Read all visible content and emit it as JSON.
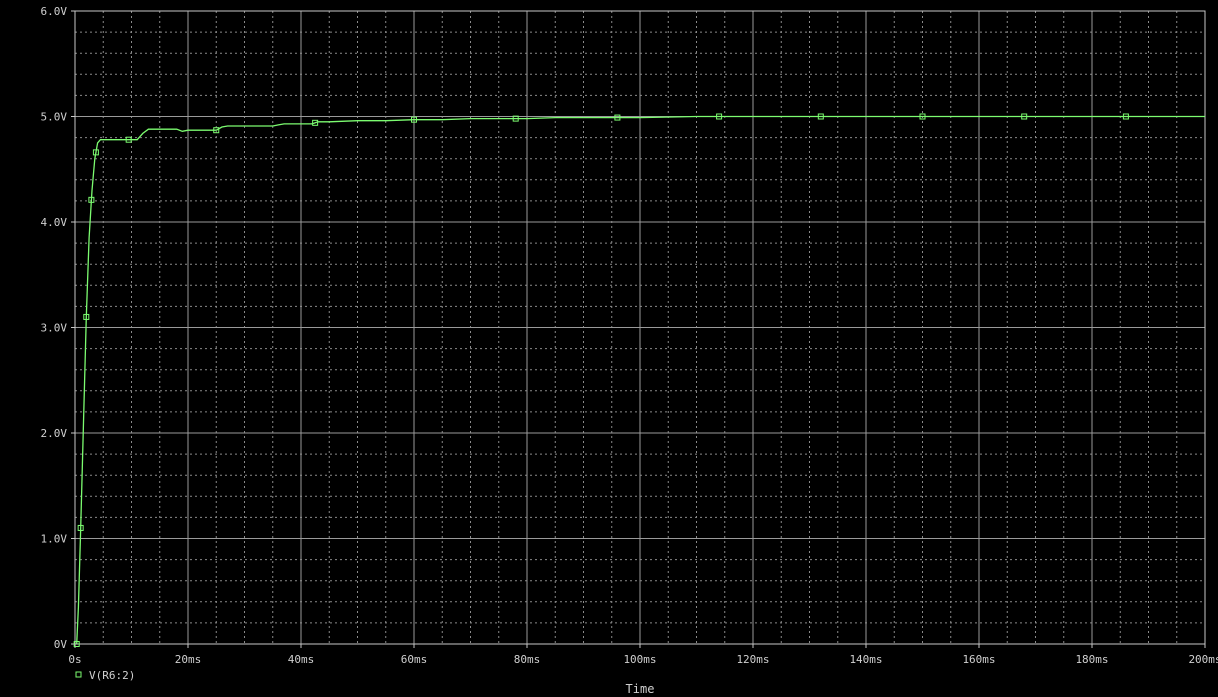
{
  "chart_data": {
    "type": "line",
    "xlabel": "Time",
    "ylabel": "",
    "xlim": [
      0,
      200
    ],
    "ylim": [
      0,
      6
    ],
    "grid": true,
    "legend_placement": "bottom-left",
    "x_ticks": [
      "0s",
      "20ms",
      "40ms",
      "60ms",
      "80ms",
      "100ms",
      "120ms",
      "140ms",
      "160ms",
      "180ms",
      "200ms"
    ],
    "y_ticks": [
      "0V",
      "1.0V",
      "2.0V",
      "3.0V",
      "4.0V",
      "5.0V",
      "6.0V"
    ],
    "series": [
      {
        "name": "V(R6:2)",
        "color": "#7CFC70",
        "x": [
          0.3,
          0.6,
          1.0,
          1.5,
          2.0,
          2.5,
          3.0,
          3.5,
          4.0,
          4.5,
          5.0,
          10.0,
          11.0,
          12.0,
          13.0,
          18.0,
          19.0,
          20.0,
          25.0,
          26.0,
          27.0,
          28.0,
          35.0,
          36.0,
          37.0,
          40.0,
          42.0,
          43.0,
          44.0,
          45.0,
          50.0,
          55.0,
          60.0,
          65.0,
          70.0,
          75.0,
          80.0,
          85.0,
          90.0,
          100.0,
          110.0,
          120.0,
          140.0,
          160.0,
          180.0,
          200.0
        ],
        "y": [
          0.0,
          0.35,
          1.1,
          2.1,
          3.1,
          3.85,
          4.3,
          4.6,
          4.75,
          4.78,
          4.78,
          4.78,
          4.78,
          4.84,
          4.88,
          4.88,
          4.86,
          4.87,
          4.87,
          4.9,
          4.91,
          4.91,
          4.91,
          4.92,
          4.93,
          4.93,
          4.93,
          4.95,
          4.95,
          4.95,
          4.96,
          4.96,
          4.97,
          4.97,
          4.98,
          4.98,
          4.98,
          4.99,
          4.99,
          4.99,
          5.0,
          5.0,
          5.0,
          5.0,
          5.0,
          5.0
        ],
        "markers_x": [
          0.3,
          1.0,
          2.0,
          2.9,
          3.7,
          9.5,
          25.0,
          42.5,
          60.0,
          78.0,
          96.0,
          114.0,
          132.0,
          150.0,
          168.0,
          186.0
        ]
      }
    ]
  }
}
